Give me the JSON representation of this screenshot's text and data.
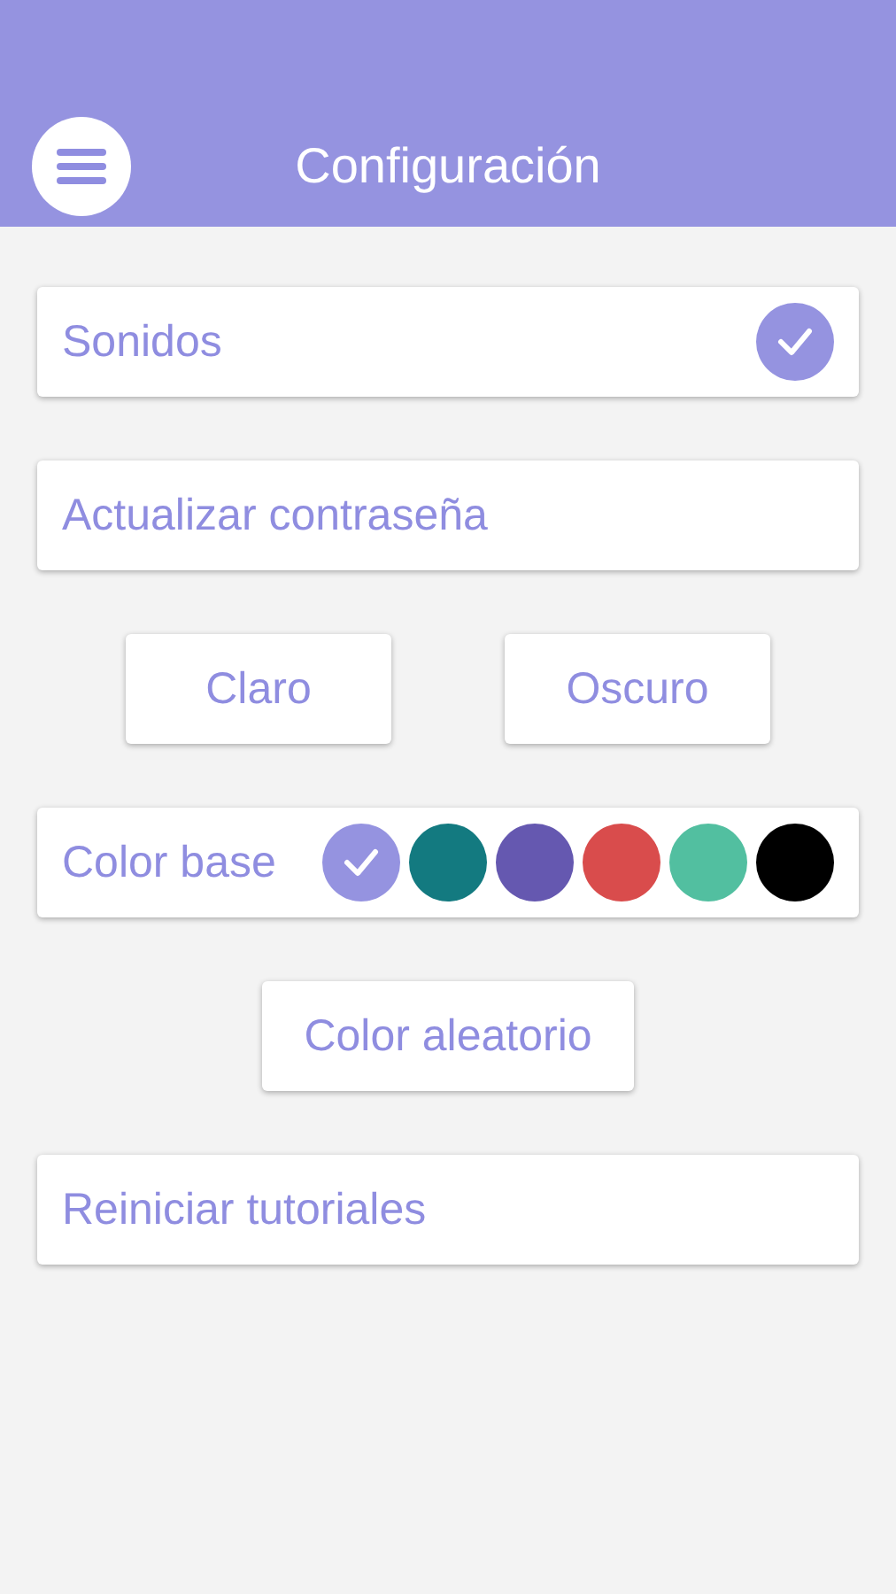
{
  "header": {
    "title": "Configuración"
  },
  "rows": [
    {
      "kind": "toggle",
      "label": "Sonidos",
      "checked": true
    },
    {
      "kind": "action",
      "label": "Actualizar contraseña"
    },
    {
      "kind": "buttons",
      "buttons": [
        "Claro",
        "Oscuro"
      ]
    },
    {
      "kind": "colors",
      "label": "Color base",
      "colors": [
        {
          "color": "#9593e0",
          "selected": true
        },
        {
          "color": "#137a80",
          "selected": false
        },
        {
          "color": "#6558b0",
          "selected": false
        },
        {
          "color": "#d94c4c",
          "selected": false
        },
        {
          "color": "#52bfa0",
          "selected": false
        },
        {
          "color": "#000000",
          "selected": false
        }
      ]
    },
    {
      "kind": "buttons",
      "buttons": [
        "Color aleatorio"
      ]
    },
    {
      "kind": "action",
      "label": "Reiniciar tutoriales"
    }
  ]
}
